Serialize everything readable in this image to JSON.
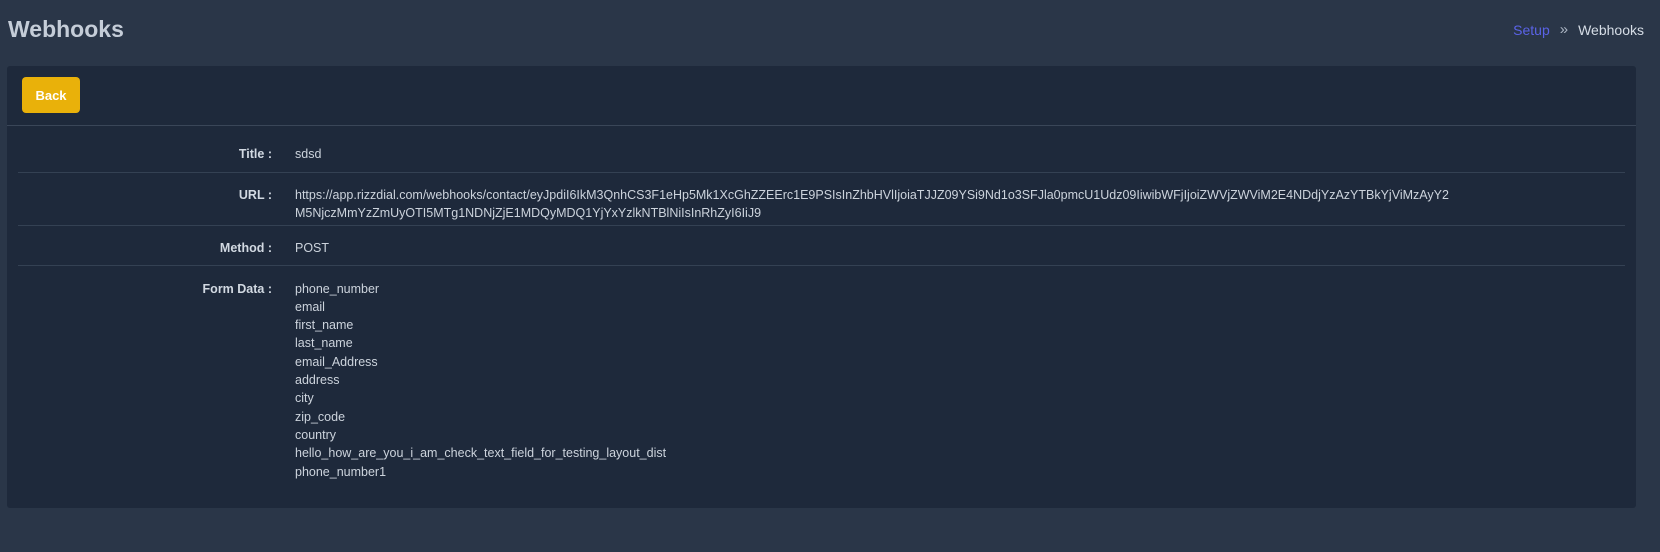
{
  "header": {
    "title": "Webhooks",
    "breadcrumb": {
      "link": "Setup",
      "separator": "»",
      "current": "Webhooks"
    }
  },
  "toolbar": {
    "back_label": "Back"
  },
  "details": {
    "title_label": "Title :",
    "title_value": "sdsd",
    "url_label": "URL :",
    "url_line1": "https://app.rizzdial.com/webhooks/contact/eyJpdiI6IkM3QnhCS3F1eHp5Mk1XcGhZZEErc1E9PSIsInZhbHVlIjoiaTJJZ09YSi9Nd1o3SFJla0pmcU1Udz09IiwibWFjIjoiZWVjZWViM2E4NDdjYzAzYTBkYjViMzAyY2",
    "url_line2": "M5NjczMmYzZmUyOTI5MTg1NDNjZjE1MDQyMDQ1YjYxYzlkNTBlNiIsInRhZyI6IiJ9",
    "method_label": "Method :",
    "method_value": "POST",
    "form_data_label": "Form Data :",
    "form_fields": [
      "phone_number",
      "email",
      "first_name",
      "last_name",
      "email_Address",
      "address",
      "city",
      "zip_code",
      "country",
      "hello_how_are_you_i_am_check_text_field_for_testing_layout_dist",
      "phone_number1"
    ]
  },
  "colors": {
    "page_bg": "#2a3648",
    "card_bg": "#1e293b",
    "accent": "#e9b10a",
    "link": "#5a63e6"
  }
}
